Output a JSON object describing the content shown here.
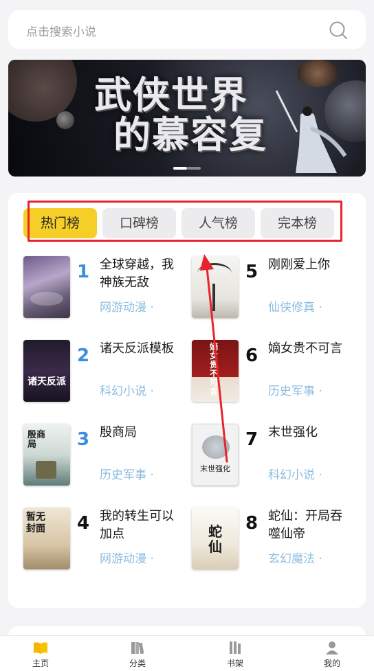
{
  "search": {
    "placeholder": "点击搜索小说"
  },
  "banner": {
    "line1": "武侠世界",
    "line2": "的慕容复"
  },
  "tabs": [
    {
      "label": "热门榜",
      "active": true
    },
    {
      "label": "口碑榜",
      "active": false
    },
    {
      "label": "人气榜",
      "active": false
    },
    {
      "label": "完本榜",
      "active": false
    }
  ],
  "books": [
    {
      "rank": "1",
      "title": "全球穿越，我神族无敌",
      "genre": "网游动漫 ·",
      "rank_color": "#3a8ee0"
    },
    {
      "rank": "2",
      "title": "诸天反派模板",
      "genre": "科幻小说 ·",
      "rank_color": "#3a8ee0"
    },
    {
      "rank": "3",
      "title": "殷商局",
      "genre": "历史军事 ·",
      "rank_color": "#3a8ee0"
    },
    {
      "rank": "4",
      "title": "我的转生可以加点",
      "genre": "网游动漫 ·",
      "rank_color": "#111111"
    },
    {
      "rank": "5",
      "title": "刚刚爱上你",
      "genre": "仙侠修真 ·",
      "rank_color": "#111111"
    },
    {
      "rank": "6",
      "title": "嫡女贵不可言",
      "genre": "历史军事 ·",
      "rank_color": "#111111"
    },
    {
      "rank": "7",
      "title": "末世强化",
      "genre": "科幻小说 ·",
      "rank_color": "#111111"
    },
    {
      "rank": "8",
      "title": "蛇仙：开局吞噬仙帝",
      "genre": "玄幻魔法 ·",
      "rank_color": "#111111"
    }
  ],
  "covers": {
    "cover2_text": "诸天反派",
    "cover3_text": "殷商局",
    "cover4_text": "暂无封面",
    "cover6_text": "嫡女贵不可言",
    "cover7_text": "末世强化",
    "cover8_text": "蛇仙"
  },
  "nav": [
    {
      "label": "主页",
      "icon": "book-open-icon",
      "active": true
    },
    {
      "label": "分类",
      "icon": "books-category-icon",
      "active": false
    },
    {
      "label": "书架",
      "icon": "bookshelf-icon",
      "active": false
    },
    {
      "label": "我的",
      "icon": "user-icon",
      "active": false
    }
  ],
  "colors": {
    "accent": "#f5cf27",
    "rank_top": "#3a8ee0",
    "genre": "#8cbde0",
    "highlight": "#e8232b"
  }
}
